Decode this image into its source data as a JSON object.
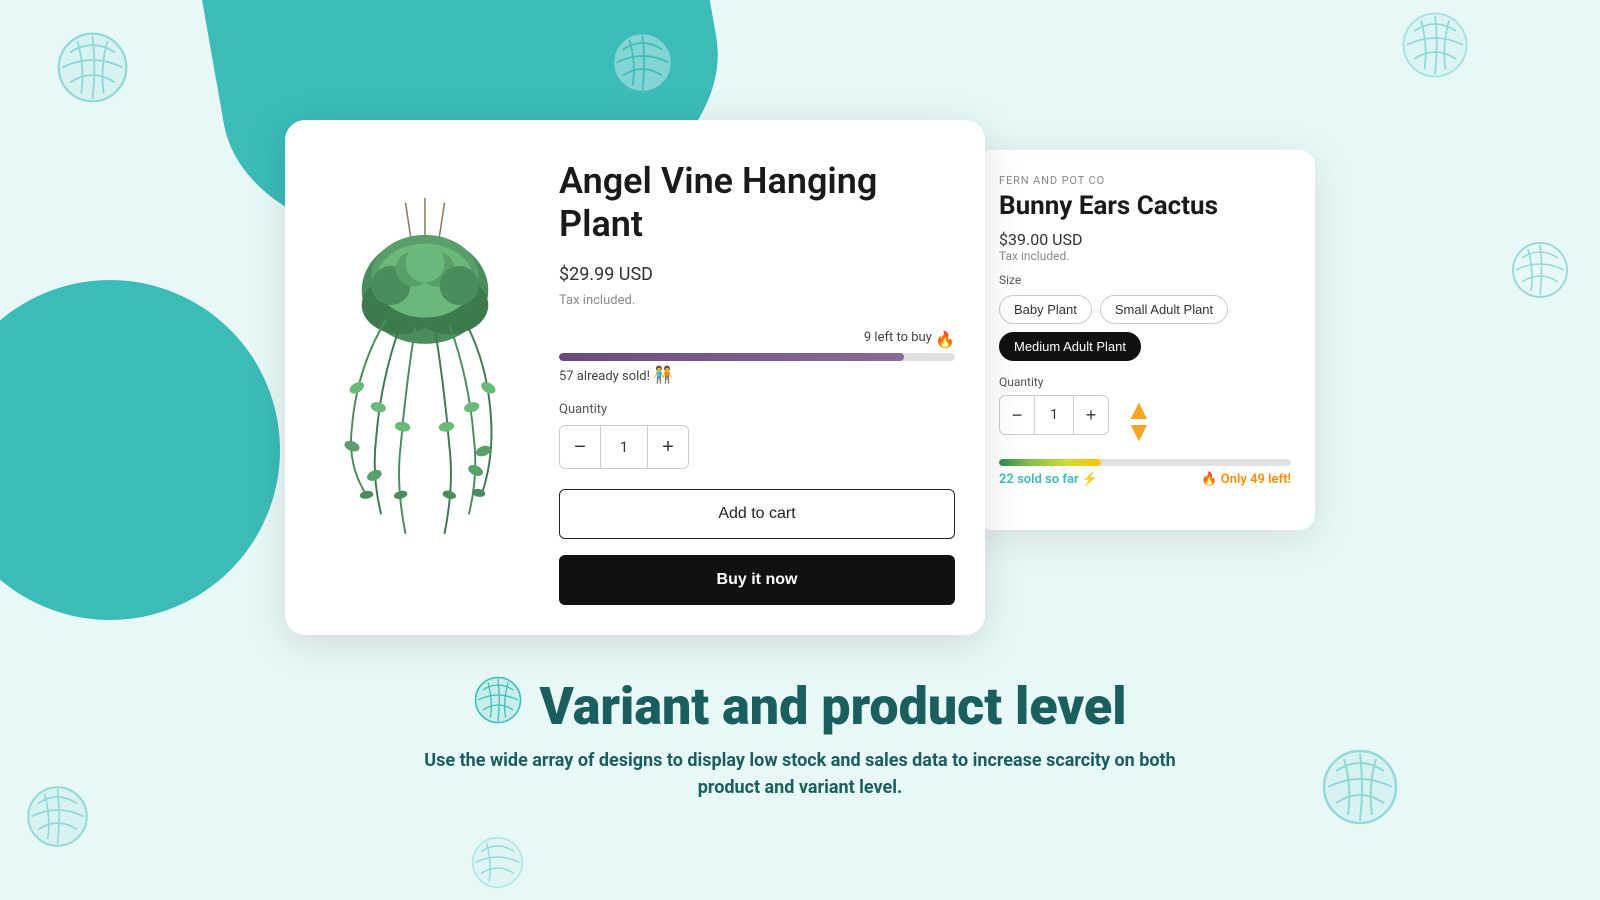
{
  "background": {
    "color": "#e8f8f7",
    "accent": "#3bbcb8"
  },
  "card1": {
    "title": "Angel Vine Hanging Plant",
    "price": "$29.99 USD",
    "tax_note": "Tax included.",
    "stock_left": "9 left to buy",
    "already_sold": "57 already sold!",
    "stock_percent": 87,
    "quantity_label": "Quantity",
    "quantity_value": "1",
    "qty_minus": "−",
    "qty_plus": "+",
    "add_to_cart": "Add to cart",
    "buy_now": "Buy it now"
  },
  "card2": {
    "brand": "FERN AND POT CO",
    "title": "Bunny Ears Cactus",
    "price": "$39.00 USD",
    "tax_note": "Tax included.",
    "size_label": "Size",
    "sizes": [
      "Baby Plant",
      "Small Adult Plant",
      "Medium Adult Plant"
    ],
    "active_size": "Medium Adult Plant",
    "quantity_label": "Quantity",
    "quantity_value": "1",
    "qty_minus": "−",
    "qty_plus": "+",
    "sold_so_far": "22 sold so far 🗲",
    "only_left": "🔥 Only 49 left!",
    "stock_percent": 35
  },
  "bottom": {
    "headline": "Variant and product level",
    "subheadline": "Use the wide array of designs to display low stock and sales data to increase scarcity on both product and variant level."
  }
}
